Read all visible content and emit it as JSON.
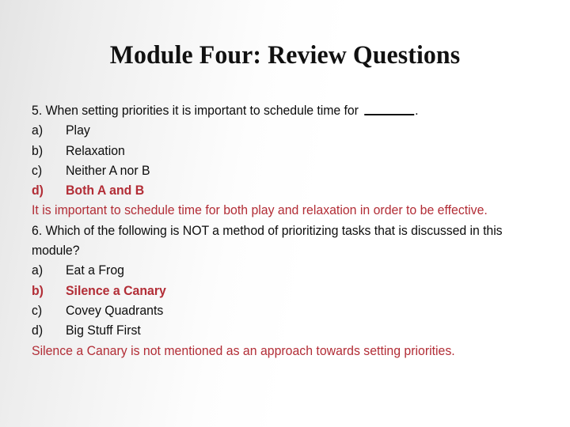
{
  "slide": {
    "title": "Module Four: Review Questions",
    "background_gradient_from": "#e4e4e4",
    "background_gradient_to": "#ffffff",
    "text_color": "#0d0d0d",
    "accent_color": "#b22d36"
  },
  "questions": [
    {
      "number": "5.",
      "stem_before_blank": "When setting priorities it is important to schedule time for ",
      "blank": "_______",
      "stem_after_blank": ".",
      "options": [
        {
          "letter": "a)",
          "text": "Play",
          "highlighted": false
        },
        {
          "letter": "b)",
          "text": "Relaxation",
          "highlighted": false
        },
        {
          "letter": "c)",
          "text": "Neither A nor B",
          "highlighted": false
        },
        {
          "letter": "d)",
          "text": "Both A and B",
          "highlighted": true
        }
      ],
      "explanation": "It is important to schedule time for both play and relaxation in order to be effective."
    },
    {
      "number": "6.",
      "stem": "Which of the following is NOT a method of prioritizing tasks that is discussed in this module?",
      "options": [
        {
          "letter": "a)",
          "text": "Eat a Frog",
          "highlighted": false
        },
        {
          "letter": "b)",
          "text": "Silence a Canary",
          "highlighted": true
        },
        {
          "letter": "c)",
          "text": "Covey Quadrants",
          "highlighted": false
        },
        {
          "letter": "d)",
          "text": "Big Stuff First",
          "highlighted": false
        }
      ],
      "explanation": "Silence a Canary is not mentioned as an approach towards setting priorities."
    }
  ]
}
